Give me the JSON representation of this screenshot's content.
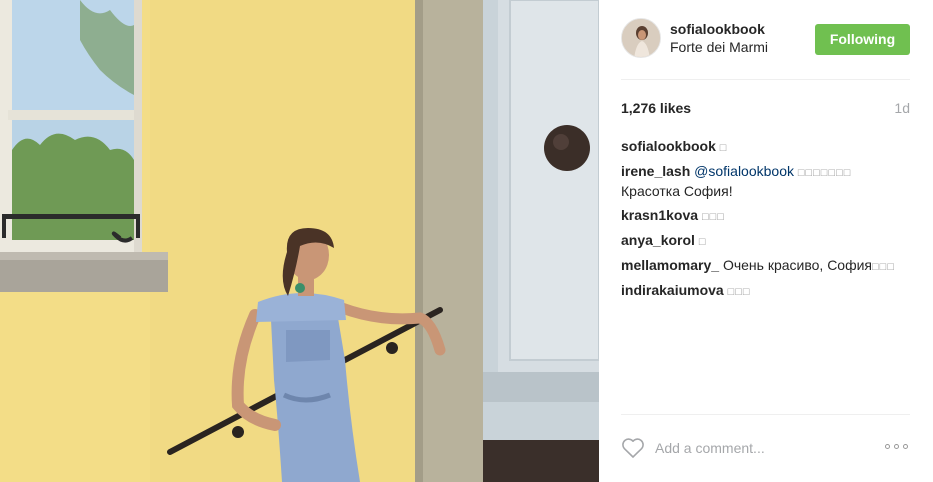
{
  "post": {
    "author": "sofialookbook",
    "location": "Forte dei Marmi",
    "follow_label": "Following",
    "likes": "1,276 likes",
    "age": "1d"
  },
  "comments": [
    {
      "user": "sofialookbook",
      "text": "",
      "emoji": "□"
    },
    {
      "user": "irene_lash",
      "mention": "@sofialookbook",
      "emoji": "□□□□□□□",
      "text": "Красотка София!"
    },
    {
      "user": "krasn1kova",
      "text": "",
      "emoji": "□□□"
    },
    {
      "user": "anya_korol",
      "text": "",
      "emoji": "□"
    },
    {
      "user": "mellamomary_",
      "text": "Очень красиво, София",
      "emoji": "□□□"
    },
    {
      "user": "indirakaiumova",
      "text": "",
      "emoji": "□□□"
    }
  ],
  "footer": {
    "comment_placeholder": "Add a comment...",
    "like_icon": "heart-outline-icon",
    "options_icon": "more-horizontal-icon"
  },
  "colors": {
    "follow_button": "#70c050",
    "mention": "#003569",
    "muted": "#a5a7aa"
  }
}
